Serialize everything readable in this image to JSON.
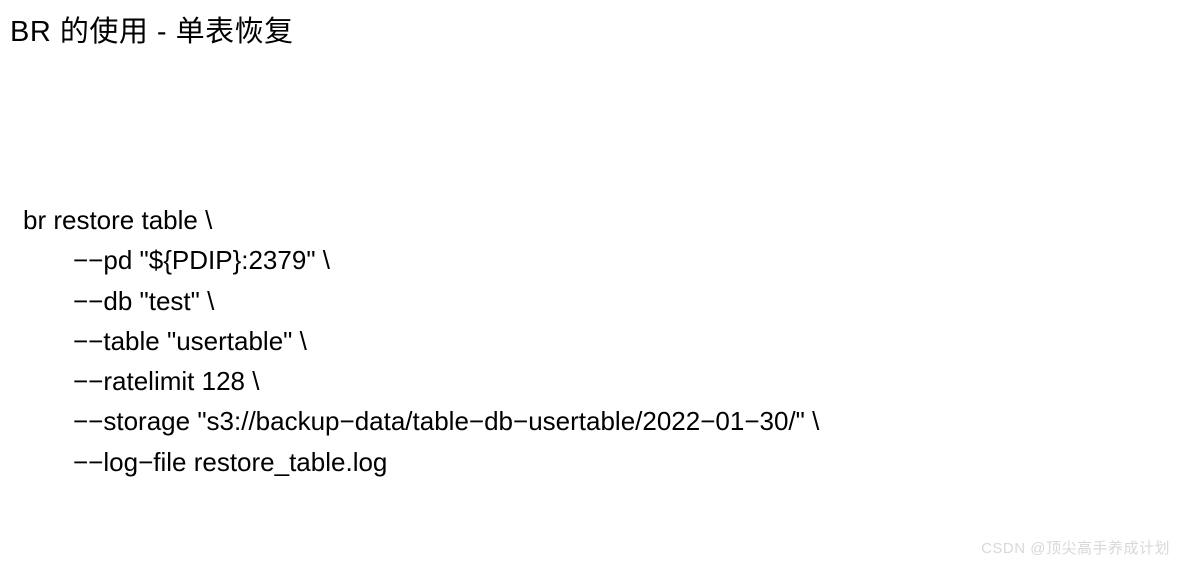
{
  "title": "BR 的使用 - 单表恢复",
  "code": {
    "line1": "br restore table \\",
    "line2": "−−pd \"${PDIP}:2379\" \\",
    "line3": "−−db \"test\" \\",
    "line4": "−−table \"usertable\" \\",
    "line5": "−−ratelimit 128 \\",
    "line6": "−−storage \"s3://backup−data/table−db−usertable/2022−01−30/\" \\",
    "line7": "−−log−file restore_table.log"
  },
  "watermark": "CSDN @顶尖高手养成计划"
}
